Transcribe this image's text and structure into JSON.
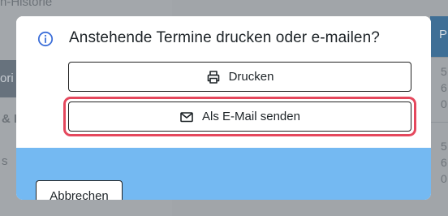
{
  "background": {
    "sidebar_fragment_1": "n-Historie",
    "sidebar_fragment_2": "ori",
    "sidebar_fragment_3": "& E",
    "sidebar_fragment_4": "s",
    "table_header_fragment": "P",
    "table_values": [
      "5",
      "6",
      "0",
      "5",
      "6",
      "0"
    ]
  },
  "dialog": {
    "title": "Anstehende Termine drucken oder e-mailen?",
    "info_icon": "info-circle-icon",
    "print_label": "Drucken",
    "print_icon": "printer-icon",
    "email_label": "Als E-Mail senden",
    "email_icon": "envelope-icon",
    "highlight_color": "#e5485d",
    "cancel_label": "Abbrechen",
    "footer_color": "#74b9f2"
  }
}
